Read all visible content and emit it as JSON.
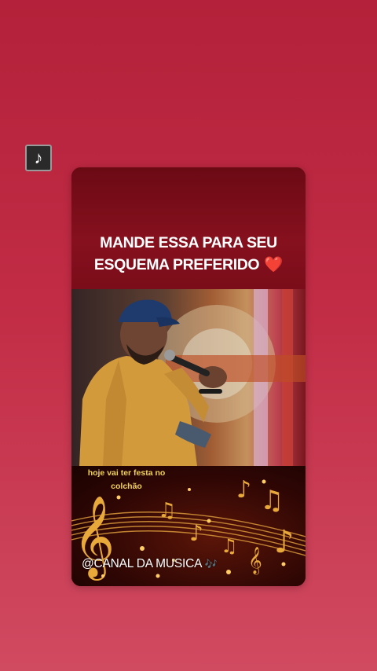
{
  "post": {
    "caption_line1": "MANDE ESSA PARA SEU",
    "caption_line2": "ESQUEMA PREFERIDO",
    "caption_emoji": "❤️",
    "music_badge_icon": "music-note-icon",
    "song_lyric_line1": "hoje vai ter festa no",
    "song_lyric_line2": "colchão",
    "channel_tag": "@CANAL DA MUSICA",
    "channel_tag_emoji": "🎶"
  },
  "colors": {
    "background": "#c22c45",
    "caption_band": "#86101e",
    "lyric_text": "#f2d35a",
    "heart": "#e8142c"
  }
}
